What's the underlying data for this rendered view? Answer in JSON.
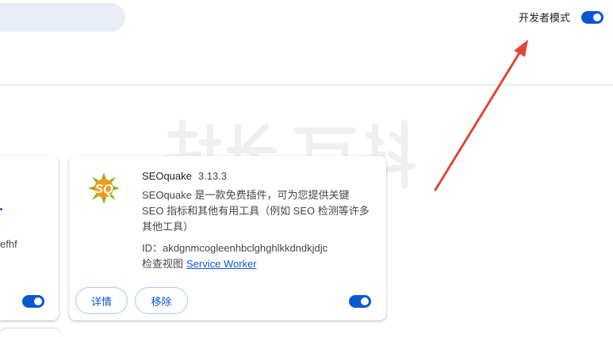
{
  "header": {
    "dev_mode_label": "开发者模式",
    "dev_mode_enabled": true
  },
  "left_card": {
    "id_fragment": "efhf",
    "enabled": true
  },
  "extension": {
    "name": "SEOquake",
    "version": "3.13.3",
    "description": "SEOquake 是一款免费插件，可为您提供关键 SEO 指标和其他有用工具（例如 SEO 检测等许多其他工具）",
    "id_text": "ID：akdgnmcogleenhbclghghlkkdndkjdjc",
    "views_label": "检查视图",
    "service_worker_link": "Service Worker",
    "details_button": "详情",
    "remove_button": "移除",
    "enabled": true,
    "logo_text": "SQ"
  },
  "colors": {
    "accent": "#0b57d0",
    "annotation_arrow": "#e0463a",
    "logo_green": "#7cb927",
    "logo_orange": "#f59a1b"
  },
  "watermark": "站长百科"
}
